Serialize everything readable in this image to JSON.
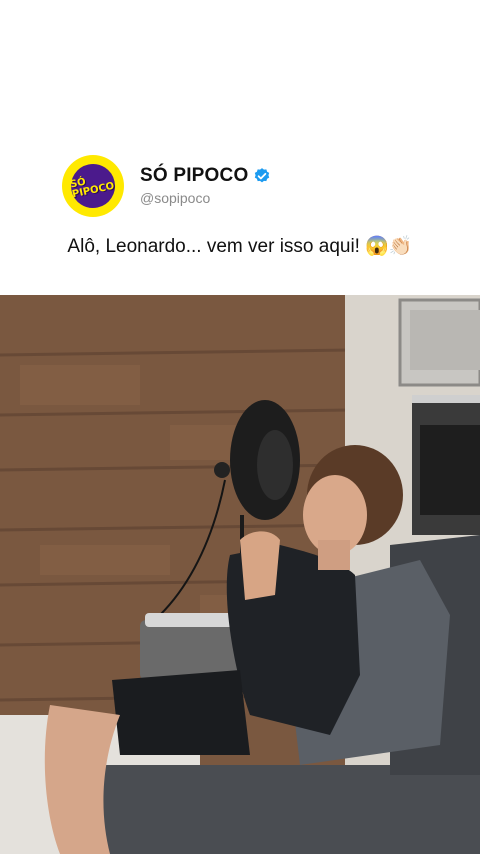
{
  "post": {
    "account_name": "SÓ PIPOCO",
    "account_handle": "@sopipoco",
    "avatar_text": "SÓ PIPOCO",
    "verified": true,
    "caption": "Alô, Leonardo... vem ver isso aqui! 😱👏🏻"
  },
  "colors": {
    "verified_badge": "#1d9bf0",
    "avatar_yellow": "#ffe900",
    "avatar_purple": "#4b1a8c"
  },
  "icons": {
    "verified": "verified-badge-icon"
  }
}
